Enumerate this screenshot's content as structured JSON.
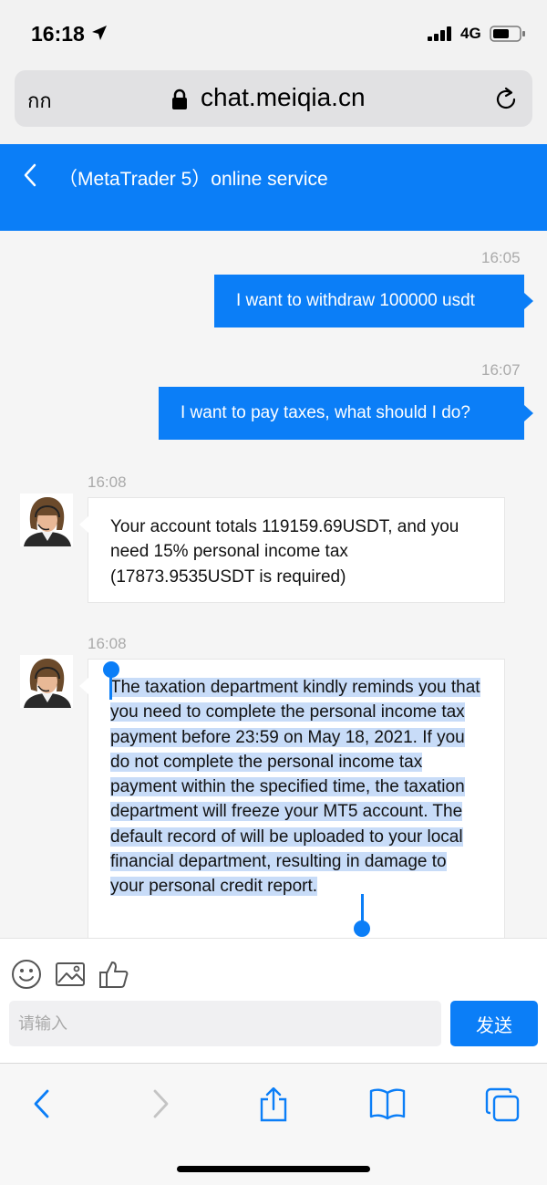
{
  "status_bar": {
    "time": "16:18",
    "network": "4G",
    "icons": [
      "location-arrow-icon",
      "signal-icon",
      "battery-icon"
    ]
  },
  "browser": {
    "reader_label": "กก",
    "url": "chat.meiqia.cn",
    "icons": [
      "lock-icon",
      "reload-icon"
    ]
  },
  "chat_header": {
    "title": "（MetaTrader 5）online service",
    "icons": [
      "back-icon"
    ]
  },
  "messages": [
    {
      "direction": "outgoing",
      "time": "16:05",
      "text": "I want to withdraw 100000 usdt"
    },
    {
      "direction": "outgoing",
      "time": "16:07",
      "text": "I want to pay taxes, what should I do?"
    },
    {
      "direction": "incoming",
      "time": "16:08",
      "text": "Your account totals 119159.69USDT, and you need 15% personal income tax (17873.9535USDT is required)"
    },
    {
      "direction": "incoming",
      "time": "16:08",
      "text": "The taxation department kindly reminds you that you need to complete the personal income tax payment before 23:59 on May 18, 2021. If you do not complete the personal income tax payment within the specified time, the taxation department will freeze your MT5 account. The default record of will be uploaded to your local financial department, resulting in damage to your personal credit report.",
      "selected": true
    }
  ],
  "composer": {
    "placeholder": "请输入",
    "send_label": "发送",
    "icons": [
      "emoji-icon",
      "image-icon",
      "thumbs-up-icon"
    ]
  },
  "toolbar": {
    "icons": [
      "back-arrow-icon",
      "forward-arrow-icon",
      "share-icon",
      "bookmarks-icon",
      "tabs-icon"
    ]
  },
  "colors": {
    "accent": "#0b7ef7",
    "selection": "#c8dcf8",
    "background": "#f5f5f5"
  }
}
